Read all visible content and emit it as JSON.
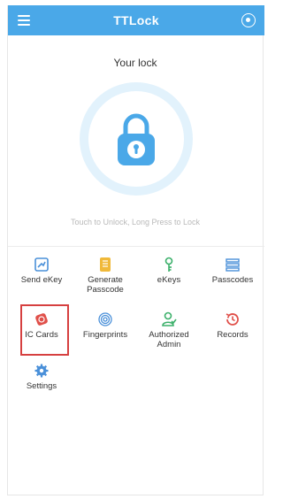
{
  "header": {
    "title": "TTLock"
  },
  "lock": {
    "name": "Your lock",
    "hint": "Touch to Unlock, Long Press to Lock"
  },
  "menu": [
    {
      "label": "Send eKey",
      "icon": "send-ekey-icon"
    },
    {
      "label": "Generate Passcode",
      "icon": "generate-passcode-icon"
    },
    {
      "label": "eKeys",
      "icon": "ekeys-icon"
    },
    {
      "label": "Passcodes",
      "icon": "passcodes-icon"
    },
    {
      "label": "IC Cards",
      "icon": "ic-cards-icon"
    },
    {
      "label": "Fingerprints",
      "icon": "fingerprint-icon"
    },
    {
      "label": "Authorized Admin",
      "icon": "authorized-admin-icon"
    },
    {
      "label": "Records",
      "icon": "records-icon"
    },
    {
      "label": "Settings",
      "icon": "settings-icon"
    }
  ],
  "colors": {
    "accent": "#4aa8e8",
    "icon_blue": "#4a90d9",
    "icon_yellow": "#f0b93a",
    "icon_green": "#3bb06a",
    "icon_red": "#e0504a",
    "highlight": "#d64040"
  }
}
